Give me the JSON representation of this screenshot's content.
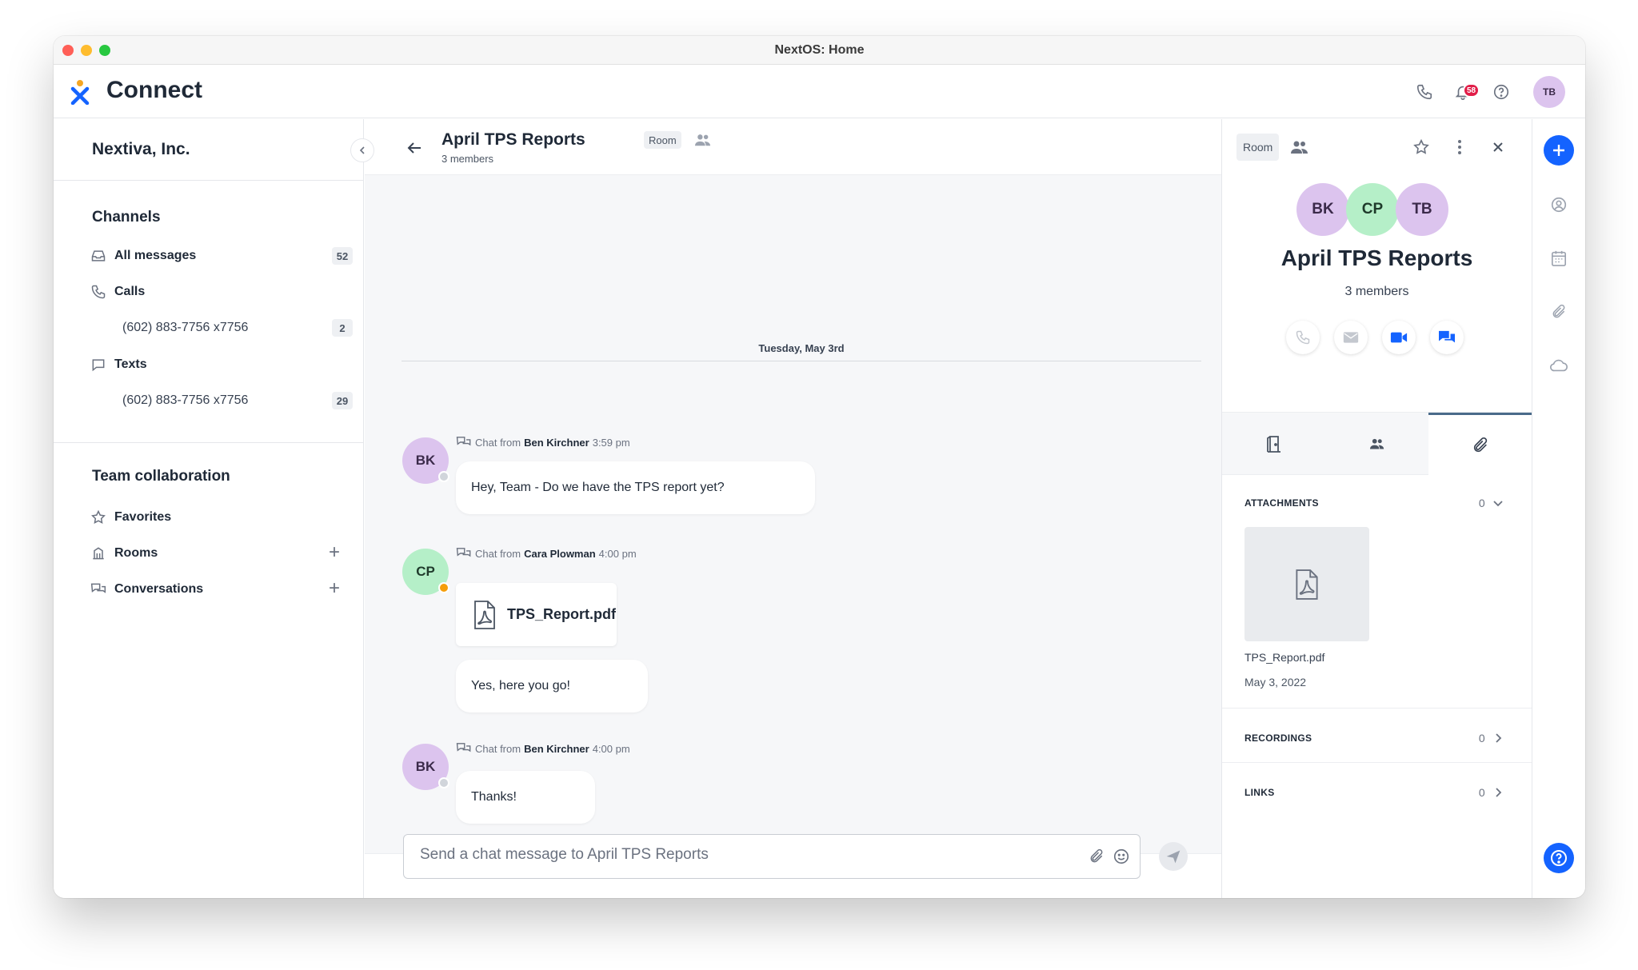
{
  "window": {
    "title": "NextOS: Home"
  },
  "app": {
    "name": "Connect",
    "notifications_count": "58",
    "user_initials": "TB",
    "brand_colors": {
      "primary": "#1463ff",
      "logo_orange": "#f5a623",
      "logo_blue": "#1463ff"
    }
  },
  "sidebar": {
    "org_name": "Nextiva, Inc.",
    "channels_heading": "Channels",
    "channels": [
      {
        "label": "All messages",
        "icon": "inbox-icon",
        "count": "52"
      },
      {
        "label": "Calls",
        "icon": "phone-icon"
      },
      {
        "label": "(602) 883-7756 x7756",
        "count": "2"
      },
      {
        "label": "Texts",
        "icon": "chat-bubble-icon"
      },
      {
        "label": "(602) 883-7756 x7756",
        "count": "29"
      }
    ],
    "team_heading": "Team collaboration",
    "team": [
      {
        "label": "Favorites",
        "icon": "star-icon"
      },
      {
        "label": "Rooms",
        "icon": "building-icon"
      },
      {
        "label": "Conversations",
        "icon": "conversations-icon"
      }
    ]
  },
  "chat": {
    "title": "April TPS Reports",
    "tag": "Room",
    "subtitle": "3 members",
    "date_separator": "Tuesday, May 3rd",
    "messages": [
      {
        "initials": "BK",
        "prefix": "Chat from",
        "sender": "Ben Kirchner",
        "time": "3:59 pm",
        "text": "Hey, Team - Do we have the TPS report yet?"
      },
      {
        "initials": "CP",
        "prefix": "Chat from",
        "sender": "Cara Plowman",
        "time": "4:00 pm",
        "file": "TPS_Report.pdf",
        "text": "Yes, here you go!"
      },
      {
        "initials": "BK",
        "prefix": "Chat from",
        "sender": "Ben Kirchner",
        "time": "4:00 pm",
        "text": "Thanks!"
      }
    ],
    "composer_placeholder": "Send a chat message to April TPS Reports"
  },
  "details": {
    "tag": "Room",
    "members": [
      "BK",
      "CP",
      "TB"
    ],
    "title": "April TPS Reports",
    "subtitle": "3 members",
    "attachments_label": "ATTACHMENTS",
    "attachments_count": "0",
    "attachment": {
      "name": "TPS_Report.pdf",
      "date": "May 3, 2022"
    },
    "recordings_label": "RECORDINGS",
    "recordings_count": "0",
    "links_label": "LINKS",
    "links_count": "0"
  }
}
